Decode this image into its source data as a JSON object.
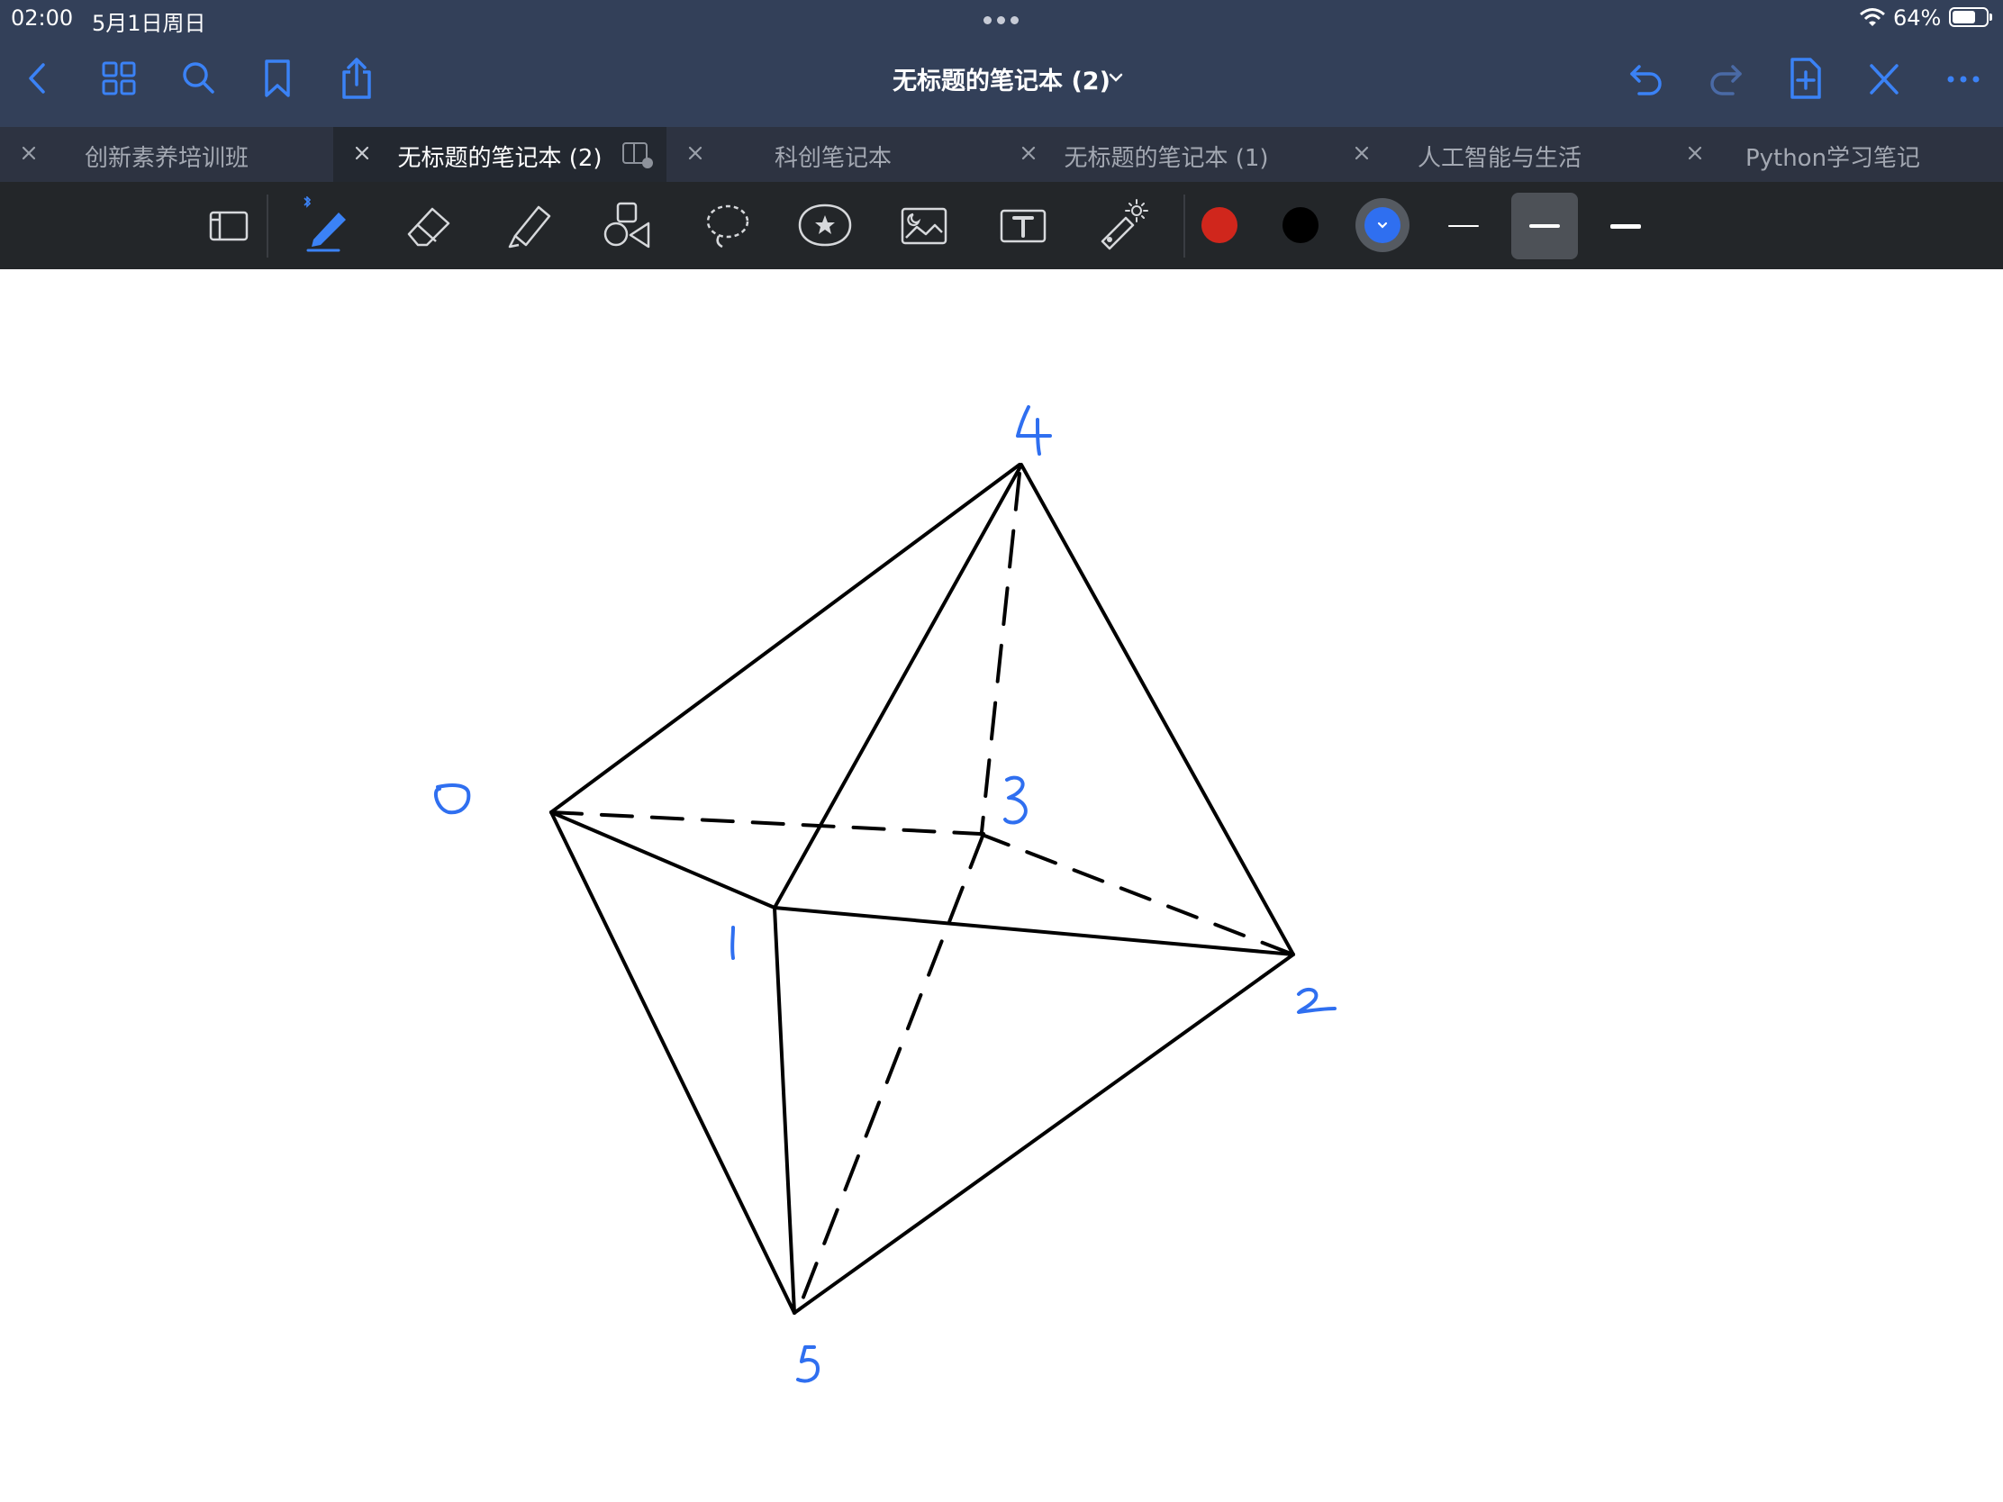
{
  "status": {
    "time": "02:00",
    "date": "5月1日周日",
    "battery": "64%"
  },
  "nav": {
    "title": "无标题的笔记本 (2)",
    "buttons": [
      "back-icon",
      "grid-icon",
      "search-icon",
      "bookmark-icon",
      "share-icon",
      "undo-icon",
      "redo-icon",
      "add-page-icon",
      "close-cross-icon",
      "more-icon"
    ]
  },
  "tabs": [
    {
      "label": "创新素养培训班",
      "active": false
    },
    {
      "label": "无标题的笔记本 (2)",
      "active": true
    },
    {
      "label": "科创笔记本",
      "active": false
    },
    {
      "label": "无标题的笔记本 (1)",
      "active": false
    },
    {
      "label": "人工智能与生活",
      "active": false
    },
    {
      "label": "Python学习笔记",
      "active": false
    }
  ],
  "toolbar": {
    "tools": [
      "page-layout-icon",
      "pen-icon",
      "eraser-icon",
      "highlighter-icon",
      "shapes-icon",
      "lasso-icon",
      "sticker-icon",
      "image-icon",
      "text-box-icon",
      "laser-pointer-icon"
    ],
    "colors": {
      "red": "#d0261c",
      "black": "#000000",
      "blue": "#2f6ff0"
    },
    "widths": [
      "thin",
      "medium",
      "thick"
    ],
    "selected_width": "medium"
  },
  "sketch": {
    "ink": "#000000",
    "label_ink": "#2f6ff0",
    "labels": [
      "0",
      "1",
      "2",
      "3",
      "4",
      "5"
    ]
  }
}
